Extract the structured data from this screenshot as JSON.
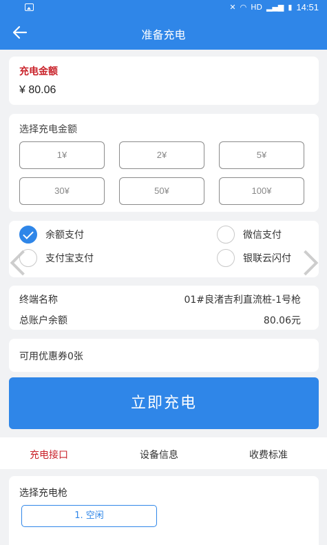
{
  "status_bar": {
    "time": "14:51",
    "network": "HD"
  },
  "navbar": {
    "title": "准备充电"
  },
  "amount": {
    "label": "充电金额",
    "value": "¥ 80.06"
  },
  "select_amount": {
    "label": "选择充电金额",
    "options": [
      "1¥",
      "2¥",
      "5¥",
      "30¥",
      "50¥",
      "100¥"
    ]
  },
  "payment": {
    "methods": [
      {
        "label": "余额支付",
        "checked": true
      },
      {
        "label": "微信支付",
        "checked": false
      },
      {
        "label": "支付宝支付",
        "checked": false
      },
      {
        "label": "银联云闪付",
        "checked": false
      }
    ]
  },
  "info": {
    "terminal_label": "终端名称",
    "terminal_value": "01#良渚吉利直流桩-1号枪",
    "balance_label": "总账户余额",
    "balance_value": "80.06元"
  },
  "coupon": {
    "text": "可用优惠券0张"
  },
  "charge_button": {
    "label": "立即充电"
  },
  "tabs": [
    {
      "label": "充电接口",
      "active": true
    },
    {
      "label": "设备信息",
      "active": false
    },
    {
      "label": "收费标准",
      "active": false
    }
  ],
  "gun": {
    "label": "选择充电枪",
    "option": "1. 空闲"
  },
  "colors": {
    "accent": "#2f86e8",
    "highlight": "#c9222a"
  }
}
